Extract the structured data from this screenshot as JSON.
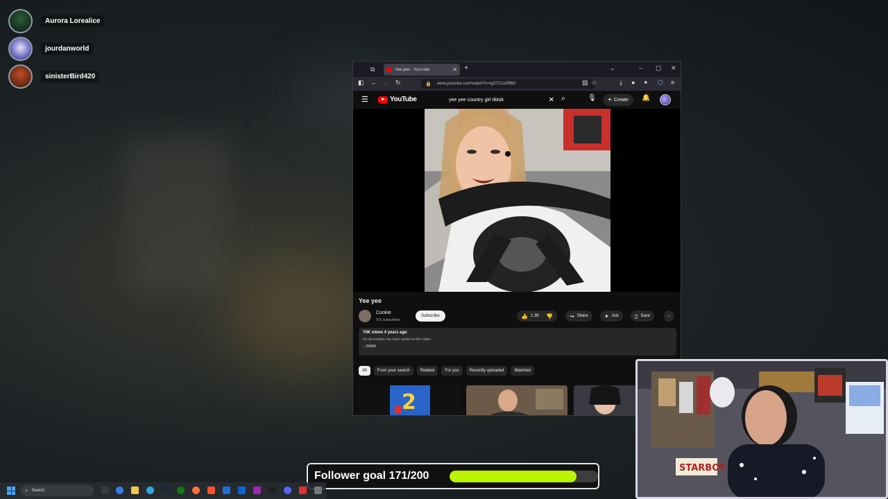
{
  "voice": {
    "users": [
      {
        "name": "Aurora Lorealice"
      },
      {
        "name": "jourdanworld"
      },
      {
        "name": "sinisterBird420"
      }
    ]
  },
  "browser": {
    "tab_title": "Yee yee - YouTube",
    "url": "www.youtube.com/watch?v=IgS7Czx3RB0"
  },
  "youtube": {
    "logo_text": "YouTube",
    "search_value": "yee yee country girl tiktok",
    "create_label": "Create",
    "video": {
      "title": "Yee yee",
      "channel": "Cookie",
      "subscribers": "971 subscribers",
      "subscribe_label": "Subscribe",
      "likes": "1.3K",
      "share_label": "Share",
      "ask_label": "Ask",
      "save_label": "Save",
      "stats": "70K views  4 years ago",
      "description": "No description has been added to this video.",
      "more_label": "...more"
    },
    "chips": [
      "All",
      "From your search",
      "Related",
      "For you",
      "Recently uploaded",
      "Watched"
    ]
  },
  "follower_goal": {
    "label": "Follower goal 171/200",
    "progress": 0.855
  },
  "taskbar": {
    "search_placeholder": "Search"
  },
  "colors": {
    "youtube_red": "#ff0000",
    "goal_fill": "#b9f500",
    "taskbar_blue": "#4aa6ff"
  }
}
